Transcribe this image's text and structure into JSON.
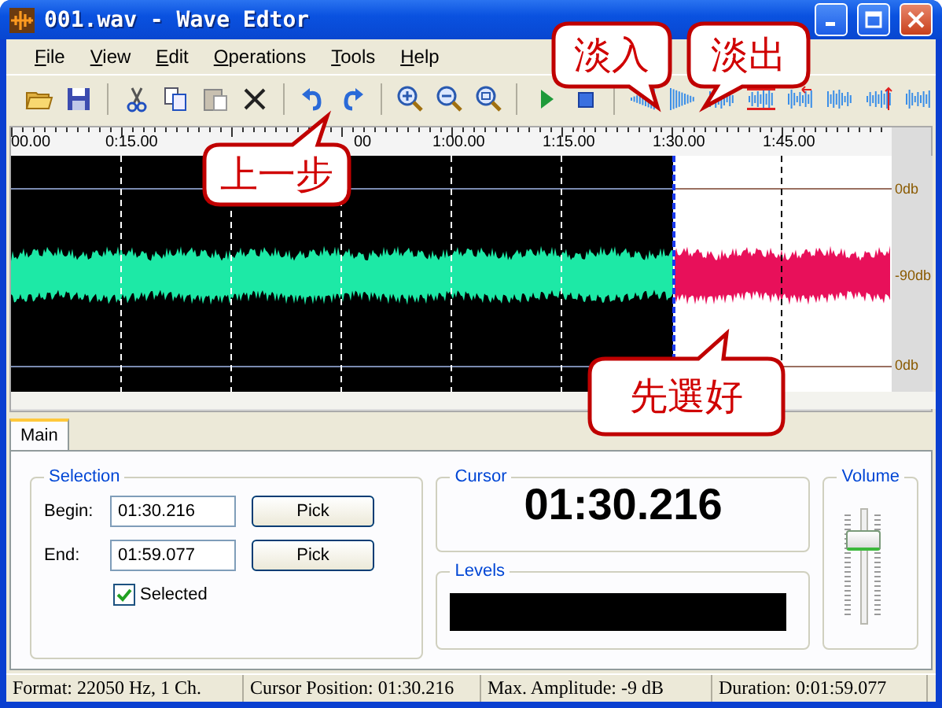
{
  "window": {
    "title": "001.wav - Wave Edtor"
  },
  "menu": [
    "File",
    "View",
    "Edit",
    "Operations",
    "Tools",
    "Help"
  ],
  "ruler": {
    "labels": [
      "00.00",
      "0:15.00",
      "00",
      "1:00.00",
      "1:15.00",
      "1:30.00",
      "1:45.00"
    ]
  },
  "waveform": {
    "db_labels": [
      "0db",
      "-90db",
      "0db"
    ]
  },
  "tabs": [
    {
      "label": "Main",
      "selected": true
    }
  ],
  "selection": {
    "title": "Selection",
    "rows": [
      {
        "label": "Begin:",
        "value": "01:30.216",
        "button": "Pick"
      },
      {
        "label": "End:",
        "value": "01:59.077",
        "button": "Pick"
      }
    ],
    "checkbox": {
      "label": "Selected",
      "checked": true
    }
  },
  "cursor": {
    "title": "Cursor",
    "time": "01:30.216"
  },
  "levels": {
    "title": "Levels"
  },
  "volume": {
    "title": "Volume",
    "level": 0.78
  },
  "status_bar": [
    "Format: 22050 Hz, 1 Ch.",
    "Cursor Position: 01:30.216",
    "Max. Amplitude: -9 dB",
    "Duration: 0:01:59.077"
  ],
  "callouts": [
    {
      "text": "淡入",
      "kind": "down"
    },
    {
      "text": "淡出",
      "kind": "down"
    },
    {
      "text": "上一步",
      "kind": "up"
    },
    {
      "text": "先選好",
      "kind": "up"
    }
  ]
}
